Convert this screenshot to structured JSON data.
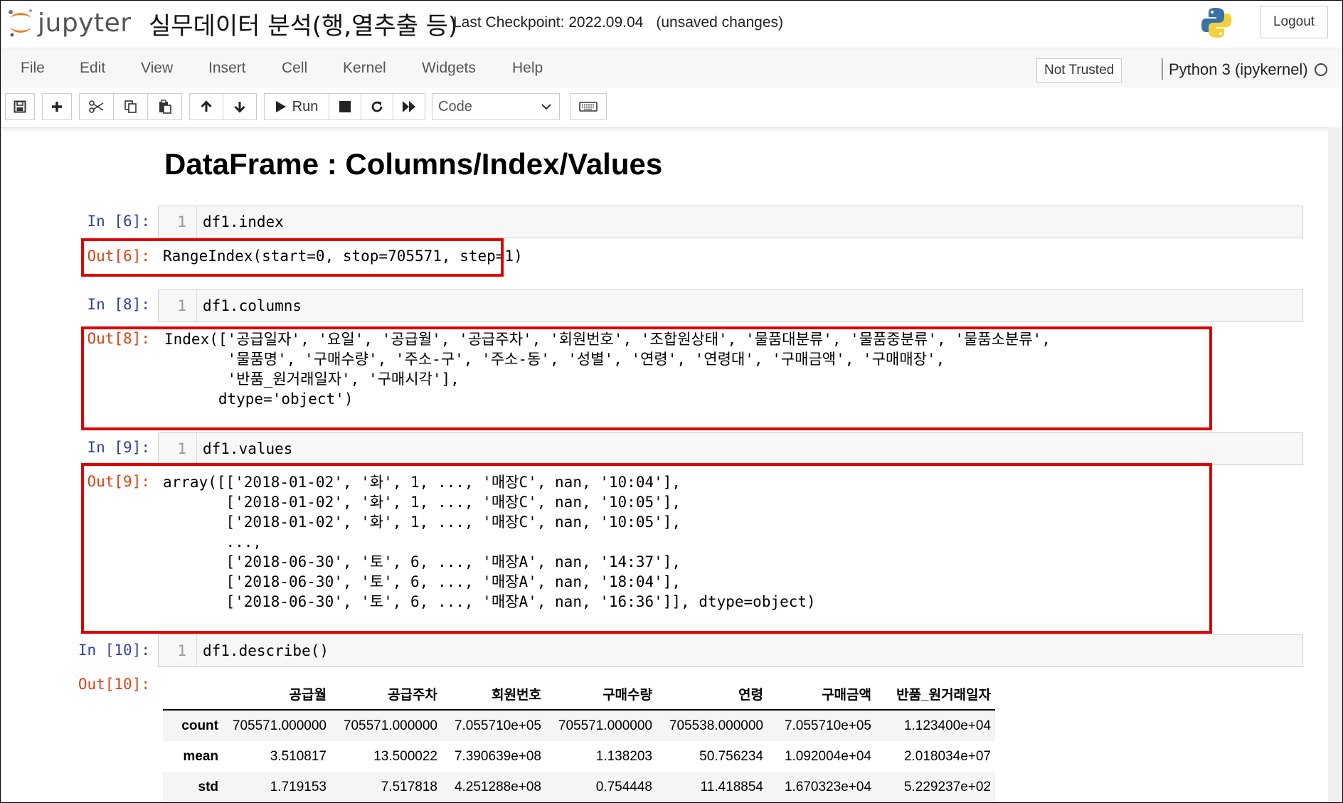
{
  "header": {
    "logo_text": "jupyter",
    "notebook_title": "실무데이터 분석(행,열추출 등)",
    "checkpoint": "Last Checkpoint: 2022.09.04",
    "save_status": "(unsaved changes)",
    "logout_label": "Logout"
  },
  "menubar": {
    "items": [
      "File",
      "Edit",
      "View",
      "Insert",
      "Cell",
      "Kernel",
      "Widgets",
      "Help"
    ],
    "trust_label": "Not Trusted",
    "kernel_name": "Python 3 (ipykernel)"
  },
  "toolbar": {
    "run_label": "Run",
    "cell_type": "Code",
    "icons": [
      "save-icon",
      "plus-icon",
      "scissors-icon",
      "copy-icon",
      "paste-icon",
      "arrow-up-icon",
      "arrow-down-icon",
      "play-icon",
      "stop-icon",
      "restart-icon",
      "fast-forward-icon",
      "keyboard-icon"
    ]
  },
  "notebook": {
    "heading": "DataFrame : Columns/Index/Values",
    "cells": [
      {
        "in_prompt": "In [6]:",
        "line_no": "1",
        "code": "df1.index",
        "out_prompt": "Out[6]:",
        "output": "RangeIndex(start=0, stop=705571, step=1)"
      },
      {
        "in_prompt": "In [8]:",
        "line_no": "1",
        "code": "df1.columns",
        "out_prompt": "Out[8]:",
        "output": "Index(['공급일자', '요일', '공급월', '공급주차', '회원번호', '조합원상태', '물품대분류', '물품중분류', '물품소분류',\n       '물품명', '구매수량', '주소-구', '주소-동', '성별', '연령', '연령대', '구매금액', '구매매장',\n       '반품_원거래일자', '구매시각'],\n      dtype='object')"
      },
      {
        "in_prompt": "In [9]:",
        "line_no": "1",
        "code": "df1.values",
        "out_prompt": "Out[9]:",
        "output": "array([['2018-01-02', '화', 1, ..., '매장C', nan, '10:04'],\n       ['2018-01-02', '화', 1, ..., '매장C', nan, '10:05'],\n       ['2018-01-02', '화', 1, ..., '매장C', nan, '10:05'],\n       ...,\n       ['2018-06-30', '토', 6, ..., '매장A', nan, '14:37'],\n       ['2018-06-30', '토', 6, ..., '매장A', nan, '18:04'],\n       ['2018-06-30', '토', 6, ..., '매장A', nan, '16:36']], dtype=object)"
      },
      {
        "in_prompt": "In [10]:",
        "line_no": "1",
        "code": "df1.describe()",
        "out_prompt": "Out[10]:"
      }
    ],
    "describe_table": {
      "columns": [
        "",
        "공급월",
        "공급주차",
        "회원번호",
        "구매수량",
        "연령",
        "구매금액",
        "반품_원거래일자"
      ],
      "rows": [
        [
          "count",
          "705571.000000",
          "705571.000000",
          "7.055710e+05",
          "705571.000000",
          "705538.000000",
          "7.055710e+05",
          "1.123400e+04"
        ],
        [
          "mean",
          "3.510817",
          "13.500022",
          "7.390639e+08",
          "1.138203",
          "50.756234",
          "1.092004e+04",
          "2.018034e+07"
        ],
        [
          "std",
          "1.719153",
          "7.517818",
          "4.251288e+08",
          "0.754448",
          "11.418854",
          "1.670323e+04",
          "5.229237e+02"
        ]
      ]
    }
  },
  "colors": {
    "in_prompt": "#303f9f",
    "out_prompt": "#d84315",
    "highlight_box": "#e00000",
    "jupyter_orange": "#f37726"
  }
}
